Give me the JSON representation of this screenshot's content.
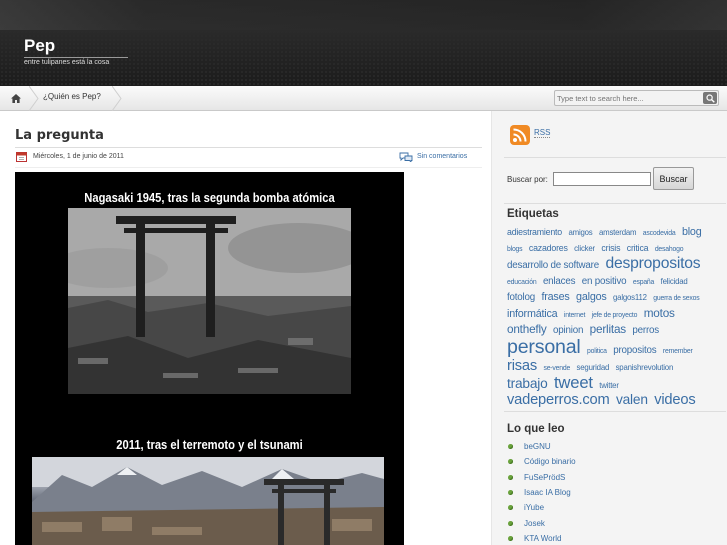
{
  "site": {
    "title": "Pep",
    "tagline": "entre tulipanes está la cosa"
  },
  "nav": {
    "home_icon": "home-icon",
    "items": [
      {
        "label": "¿Quién es Pep?"
      }
    ],
    "search_placeholder": "Type text to search here..."
  },
  "post": {
    "title": "La pregunta",
    "date": "Miércoles, 1 de junio de 2011",
    "comments_label": "Sin comentarios",
    "image": {
      "caption_top": "Nagasaki 1945, tras la segunda bomba atómica",
      "caption_bottom": "2011, tras el terremoto y el tsunami"
    }
  },
  "sidebar": {
    "rss_label": "RSS",
    "search_label": "Buscar por:",
    "search_value": "",
    "search_button": "Buscar",
    "tags_title": "Etiquetas",
    "tags": [
      {
        "label": "adiestramiento",
        "size": 9
      },
      {
        "label": "amigos",
        "size": 8
      },
      {
        "label": "amsterdam",
        "size": 8
      },
      {
        "label": "ascodevida",
        "size": 7
      },
      {
        "label": "blog",
        "size": 11
      },
      {
        "label": "blogs",
        "size": 7
      },
      {
        "label": "cazadores",
        "size": 9
      },
      {
        "label": "clicker",
        "size": 8
      },
      {
        "label": "crisis",
        "size": 9
      },
      {
        "label": "critica",
        "size": 9
      },
      {
        "label": "desahogo",
        "size": 7
      },
      {
        "label": "desarrollo de software",
        "size": 10
      },
      {
        "label": "despropositos",
        "size": 16
      },
      {
        "label": "educación",
        "size": 7
      },
      {
        "label": "enlaces",
        "size": 10
      },
      {
        "label": "en positivo",
        "size": 10
      },
      {
        "label": "españa",
        "size": 7
      },
      {
        "label": "felicidad",
        "size": 8
      },
      {
        "label": "fotolog",
        "size": 10
      },
      {
        "label": "frases",
        "size": 11
      },
      {
        "label": "galgos",
        "size": 11
      },
      {
        "label": "galgos112",
        "size": 8
      },
      {
        "label": "guerra de sexos",
        "size": 7
      },
      {
        "label": "informática",
        "size": 11
      },
      {
        "label": "internet",
        "size": 7
      },
      {
        "label": "jefe de proyecto",
        "size": 7
      },
      {
        "label": "motos",
        "size": 12
      },
      {
        "label": "onthefly",
        "size": 12
      },
      {
        "label": "opinion",
        "size": 10
      },
      {
        "label": "perlitas",
        "size": 12
      },
      {
        "label": "perros",
        "size": 10
      },
      {
        "label": "personal",
        "size": 20
      },
      {
        "label": "politica",
        "size": 7
      },
      {
        "label": "propositos",
        "size": 10
      },
      {
        "label": "remember",
        "size": 7
      },
      {
        "label": "risas",
        "size": 15
      },
      {
        "label": "se-vende",
        "size": 7
      },
      {
        "label": "seguridad",
        "size": 8
      },
      {
        "label": "spanishrevolution",
        "size": 8
      },
      {
        "label": "trabajo",
        "size": 14
      },
      {
        "label": "tweet",
        "size": 17
      },
      {
        "label": "twitter",
        "size": 8
      },
      {
        "label": "vadeperros.com",
        "size": 15
      },
      {
        "label": "valen",
        "size": 14
      },
      {
        "label": "videos",
        "size": 15
      }
    ],
    "links_title": "Lo que leo",
    "links": [
      "beGNU",
      "Código binario",
      "FuSePrödS",
      "Isaac IA Blog",
      "iYube",
      "Josek",
      "KTA World"
    ]
  },
  "colors": {
    "link": "#3a6ea5",
    "header_bg": "#1d1d1d",
    "bullet": "#6aa33b",
    "rss": "#f08a24"
  }
}
